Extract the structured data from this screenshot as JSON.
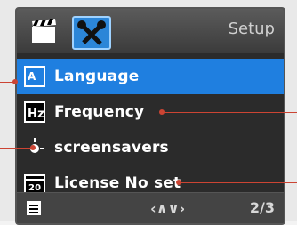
{
  "header": {
    "title": "Setup",
    "tabs": [
      {
        "icon": "clapperboard-icon"
      },
      {
        "icon": "tools-icon"
      }
    ]
  },
  "menu": {
    "items": [
      {
        "label": "Language",
        "icon": "language-icon",
        "active": true
      },
      {
        "label": "Frequency",
        "icon": "hz-icon",
        "active": false
      },
      {
        "label": "screensavers",
        "icon": "brightness-icon",
        "active": false
      },
      {
        "label": "License No set",
        "icon": "calendar-icon",
        "active": false
      }
    ]
  },
  "footer": {
    "nav": "‹∧∨›",
    "page": "2/3",
    "icon": "menu-page-icon"
  },
  "colors": {
    "accent": "#1f7fe0",
    "callout": "#c43c32"
  }
}
